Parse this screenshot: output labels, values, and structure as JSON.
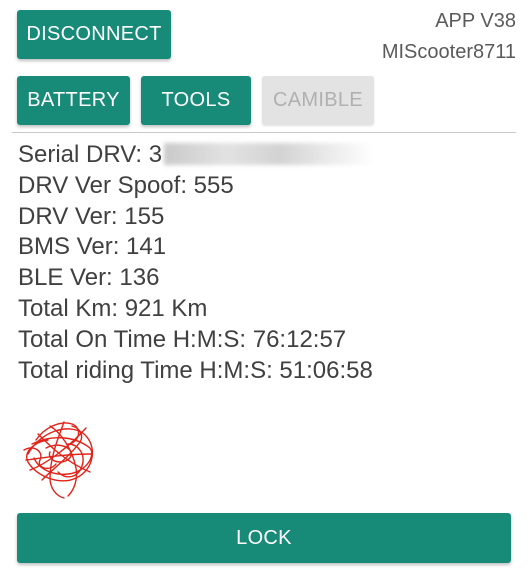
{
  "header": {
    "disconnect_label": "DISCONNECT",
    "app_version": "APP V38",
    "device_name": "MIScooter8711"
  },
  "tabs": [
    {
      "label": "BATTERY",
      "enabled": true
    },
    {
      "label": "TOOLS",
      "enabled": true
    },
    {
      "label": "CAMIBLE",
      "enabled": false
    }
  ],
  "info": {
    "serial_label": "Serial DRV: 3",
    "lines": [
      "DRV Ver Spoof: 555",
      "DRV Ver: 155",
      "BMS Ver: 141",
      "BLE Ver: 136",
      "Total Km: 921 Km",
      "Total On Time H:M:S: 76:12:57",
      "Total riding Time H:M:S: 51:06:58"
    ]
  },
  "lock_label": "LOCK",
  "colors": {
    "accent": "#188a78",
    "disabled_bg": "#e3e3e3",
    "disabled_text": "#b0b0b0",
    "text": "#404040",
    "signature": "#e2231a"
  }
}
